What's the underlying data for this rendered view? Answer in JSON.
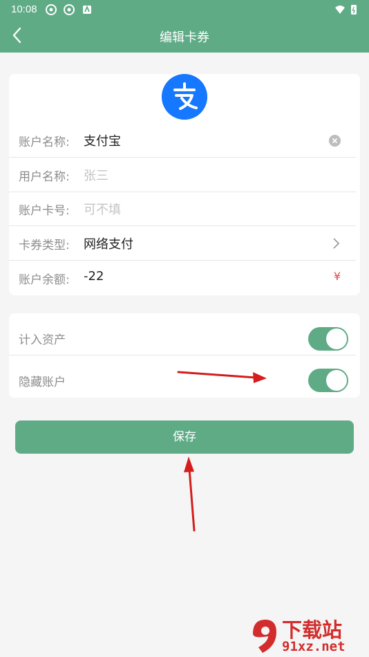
{
  "status_bar": {
    "time": "10:08"
  },
  "header": {
    "title": "编辑卡券"
  },
  "colors": {
    "primary": "#5fab86",
    "alipay_blue": "#1677ff",
    "accent_red": "#e04848"
  },
  "logo": {
    "icon": "alipay-icon"
  },
  "form": {
    "account_name": {
      "label": "账户名称:",
      "value": "支付宝"
    },
    "user_name": {
      "label": "用户名称:",
      "placeholder": "张三"
    },
    "account_number": {
      "label": "账户卡号:",
      "placeholder": "可不填"
    },
    "card_type": {
      "label": "卡券类型:",
      "value": "网络支付"
    },
    "balance": {
      "label": "账户余额:",
      "value": "-22",
      "currency": "¥"
    }
  },
  "switches": {
    "count_assets": {
      "label": "计入资产",
      "on": true
    },
    "hide_account": {
      "label": "隐藏账户",
      "on": true
    }
  },
  "save_button": {
    "label": "保存"
  },
  "watermark": {
    "title": "下载站",
    "url": "91xz.net"
  }
}
